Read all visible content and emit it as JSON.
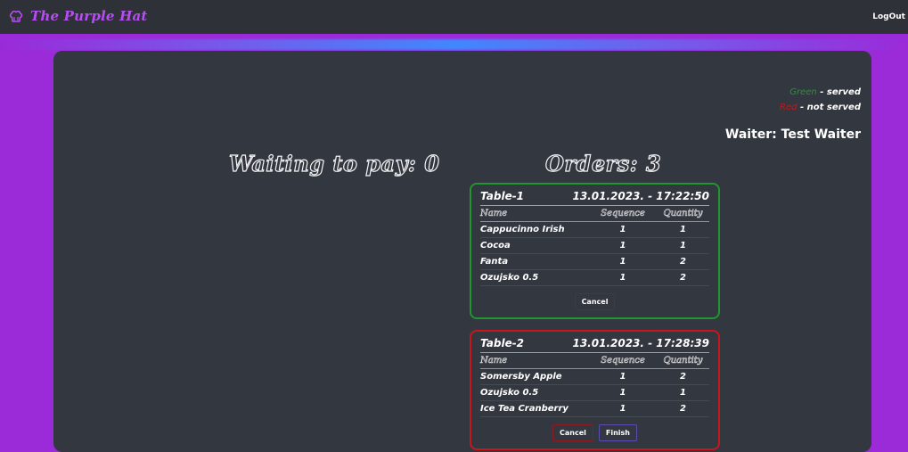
{
  "header": {
    "brand": "The Purple Hat",
    "logout_label": "LogOut"
  },
  "legend": {
    "green_word": "Green",
    "green_text": " - served",
    "red_word": "Red",
    "red_text": " - not served"
  },
  "waiter_label": "Waiter: Test Waiter",
  "waiting_title": "Waiting to pay: 0",
  "orders_title": "Orders: 3",
  "colors": {
    "served": "#22952f",
    "not_served": "#c8161c",
    "brand": "#b94df5",
    "background": "#9b2bd9"
  },
  "orders": [
    {
      "table": "Table-1",
      "datetime": "13.01.2023. - 17:22:50",
      "status": "served",
      "columns": [
        "Name",
        "Sequence",
        "Quantity"
      ],
      "items": [
        {
          "name": "Cappucinno Irish",
          "sequence": "1",
          "quantity": "1"
        },
        {
          "name": "Cocoa",
          "sequence": "1",
          "quantity": "1"
        },
        {
          "name": "Fanta",
          "sequence": "1",
          "quantity": "2"
        },
        {
          "name": "Ozujsko 0.5",
          "sequence": "1",
          "quantity": "2"
        }
      ],
      "buttons": [
        "Cancel"
      ]
    },
    {
      "table": "Table-2",
      "datetime": "13.01.2023. - 17:28:39",
      "status": "not served",
      "columns": [
        "Name",
        "Sequence",
        "Quantity"
      ],
      "items": [
        {
          "name": "Somersby Apple",
          "sequence": "1",
          "quantity": "2"
        },
        {
          "name": "Ozujsko 0.5",
          "sequence": "1",
          "quantity": "1"
        },
        {
          "name": "Ice Tea Cranberry",
          "sequence": "1",
          "quantity": "2"
        }
      ],
      "buttons": [
        "Cancel",
        "Finish"
      ]
    }
  ]
}
